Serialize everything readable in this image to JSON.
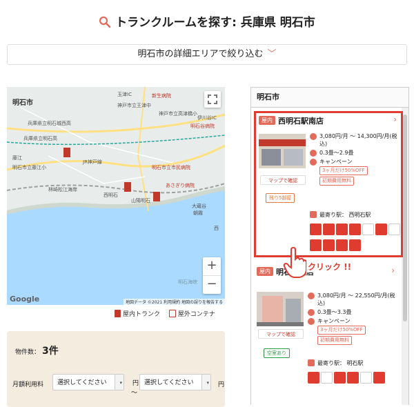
{
  "page": {
    "title": "トランクルームを探す: 兵庫県 明石市",
    "filter_label": "明石市の詳細エリアで絞り込む"
  },
  "map": {
    "labels": {
      "city": "明石市",
      "l1": "新生病院",
      "l2": "神戸市立王津中",
      "l3": "玉津IC",
      "l4": "兵庫県立明石城西高",
      "l5": "兵庫県立明石高",
      "l6": "神戸市立高津橋小",
      "l7": "伊川谷IC",
      "l8": "明石谷病院",
      "l9": "藤江",
      "l10": "明石市立藤江小",
      "l11": "JR神戸線",
      "l12": "明石市立市民病院",
      "l13": "あさぎり病院",
      "l14": "林崎松江海岸",
      "l15": "西明石",
      "l16": "山陽明石",
      "l17": "大蔵谷",
      "l18": "朝霧",
      "l19": "西",
      "l20": "明石海峡"
    },
    "google": "Google",
    "attribution": "地図データ ©2021 利用規約 地図の誤りを報告する"
  },
  "legend": {
    "indoor": "屋内トランク",
    "outdoor": "屋外コンテナ"
  },
  "search": {
    "count_label": "物件数：",
    "count_value": "3件",
    "price_label": "月額利用料",
    "select_placeholder": "選択してください",
    "yen": "円",
    "tilde": "～"
  },
  "list": {
    "header": "明石市",
    "cards": [
      {
        "badge": "屋内",
        "name": "西明石駅南店",
        "price": "3,080円/月 ～ 14,300円/月(税込)",
        "size": "0.3畳～2.9畳",
        "campaign": "キャンペーン",
        "tag1": "3ヶ月だけ50%OFF",
        "tag2": "初期費用無料",
        "map_button": "マップで確認",
        "remain": "残り5部屋",
        "station": "最寄り駅：  西明石駅"
      },
      {
        "badge": "屋内",
        "name": "明石駅前店",
        "price": "3,080円/月 ～ 22,550円/月(税込)",
        "size": "0.3畳～3.3畳",
        "campaign": "キャンペーン",
        "tag1": "3ヶ月だけ50%OFF",
        "tag2": "初期費用無料",
        "map_button": "マップで確認",
        "remain": "空室あり",
        "station": "最寄り駅：  明石駅"
      }
    ]
  },
  "annotation": {
    "click": "クリック !!"
  },
  "colors": {
    "accent": "#e03b2f",
    "badge": "#e26b5b",
    "panel": "#f5ece0"
  }
}
